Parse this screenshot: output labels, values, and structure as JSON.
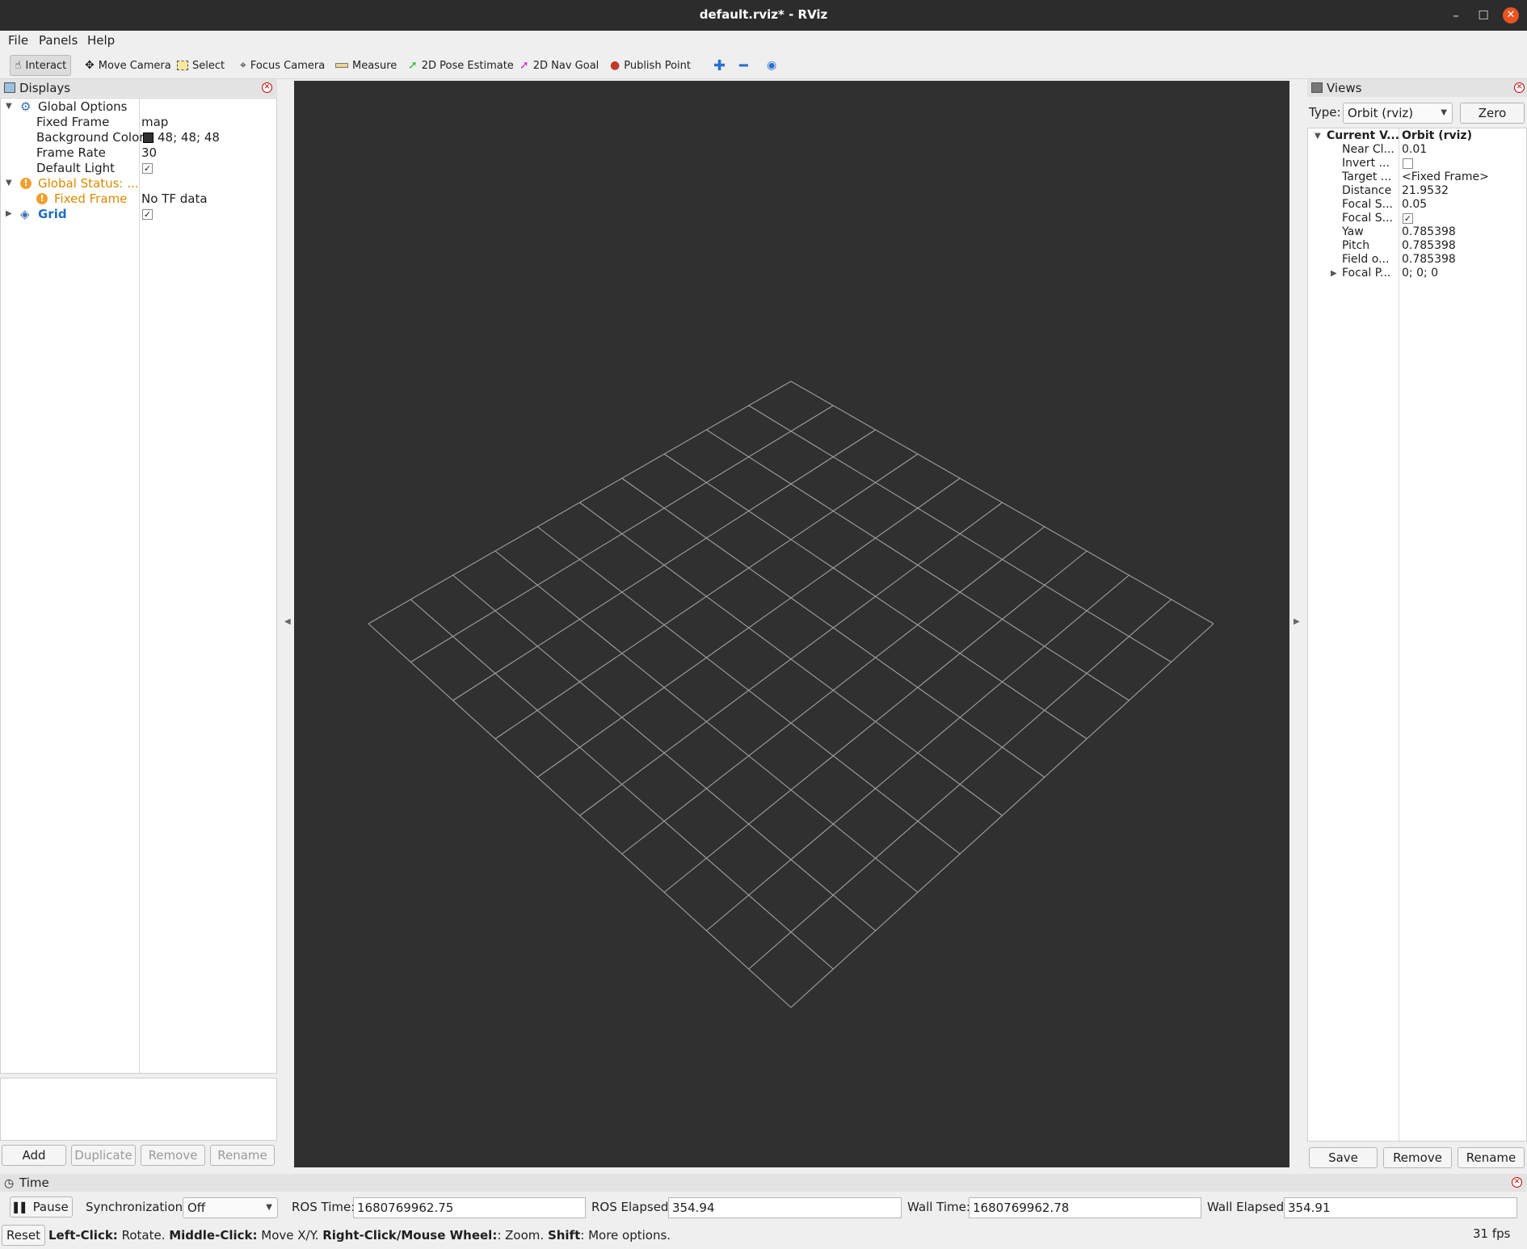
{
  "window": {
    "title": "default.rviz* - RViz"
  },
  "menu": [
    "File",
    "Panels",
    "Help"
  ],
  "toolbar": {
    "interact": "Interact",
    "move_camera": "Move Camera",
    "select": "Select",
    "focus_camera": "Focus Camera",
    "measure": "Measure",
    "pose_estimate": "2D Pose Estimate",
    "nav_goal": "2D Nav Goal",
    "publish_point": "Publish Point"
  },
  "displays": {
    "title": "Displays",
    "global_options": "Global Options",
    "fixed_frame_label": "Fixed Frame",
    "fixed_frame_value": "map",
    "bg_color_label": "Background Color",
    "bg_color_value": "48; 48; 48",
    "frame_rate_label": "Frame Rate",
    "frame_rate_value": "30",
    "default_light_label": "Default Light",
    "default_light_checked": true,
    "global_status": "Global Status: ...",
    "status_fixed_frame": "Fixed Frame",
    "status_value": "No TF data",
    "grid": "Grid",
    "grid_checked": true,
    "buttons": {
      "add": "Add",
      "duplicate": "Duplicate",
      "remove": "Remove",
      "rename": "Rename"
    }
  },
  "views": {
    "title": "Views",
    "type_label": "Type:",
    "type_value": "Orbit (rviz)",
    "zero": "Zero",
    "current_label": "Current V...",
    "current_value": "Orbit (rviz)",
    "props": [
      {
        "name": "Near Cl...",
        "value": "0.01"
      },
      {
        "name": "Invert ...",
        "value": ""
      },
      {
        "name": "Target ...",
        "value": "<Fixed Frame>"
      },
      {
        "name": "Distance",
        "value": "21.9532"
      },
      {
        "name": "Focal S...",
        "value": "0.05"
      },
      {
        "name": "Focal S...",
        "value": ""
      },
      {
        "name": "Yaw",
        "value": "0.785398"
      },
      {
        "name": "Pitch",
        "value": "0.785398"
      },
      {
        "name": "Field o...",
        "value": "0.785398"
      },
      {
        "name": "Focal P...",
        "value": "0; 0; 0"
      }
    ],
    "focal_shape_checked": true,
    "buttons": {
      "save": "Save",
      "remove": "Remove",
      "rename": "Rename"
    }
  },
  "time": {
    "title": "Time",
    "pause": "Pause",
    "sync_label": "Synchronization:",
    "sync_value": "Off",
    "ros_time_label": "ROS Time:",
    "ros_time": "1680769962.75",
    "ros_elapsed_label": "ROS Elapsed:",
    "ros_elapsed": "354.94",
    "wall_time_label": "Wall Time:",
    "wall_time": "1680769962.78",
    "wall_elapsed_label": "Wall Elapsed:",
    "wall_elapsed": "354.91"
  },
  "status": {
    "reset": "Reset",
    "b1": "Left-Click:",
    "t1": " Rotate. ",
    "b2": "Middle-Click:",
    "t2": " Move X/Y. ",
    "b3": "Right-Click/Mouse Wheel:",
    "t3": ": Zoom. ",
    "b4": "Shift",
    "t4": ": More options.",
    "fps": "31 fps"
  },
  "colors": {
    "viewport_bg": "#303030",
    "grid_line": "#a0a0a0",
    "warning": "#d98a00",
    "link_blue": "#1e6fc0"
  }
}
